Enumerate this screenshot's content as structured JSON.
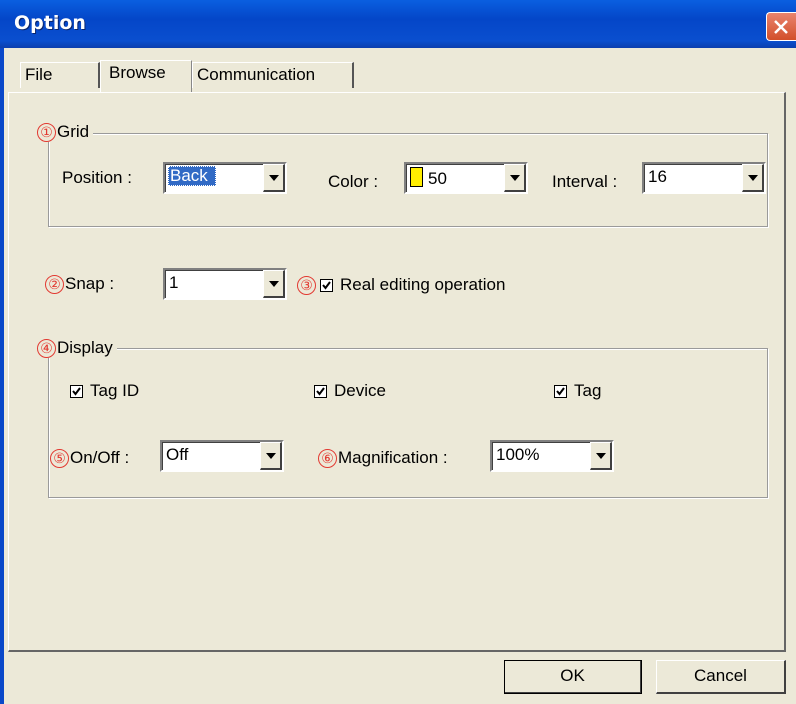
{
  "window": {
    "title": "Option",
    "close_icon": "close-icon"
  },
  "tabs": [
    {
      "label": "File",
      "active": false
    },
    {
      "label": "Browse",
      "active": true
    },
    {
      "label": "Communication",
      "active": false
    }
  ],
  "grid": {
    "number": "①",
    "legend": "Grid",
    "position_label": "Position :",
    "position_value": "Back",
    "color_label": "Color :",
    "color_value": "50",
    "color_swatch": "#ffee00",
    "interval_label": "Interval :",
    "interval_value": "16"
  },
  "snap": {
    "number": "②",
    "label": "Snap :",
    "value": "1"
  },
  "real_editing": {
    "number": "③",
    "label": "Real editing operation",
    "checked": true
  },
  "display": {
    "number": "④",
    "legend": "Display",
    "tag_id_label": "Tag ID",
    "device_label": "Device",
    "tag_label": "Tag",
    "onoff_number": "⑤",
    "onoff_label": "On/Off :",
    "onoff_value": "Off",
    "magnification_number": "⑥",
    "magnification_label": "Magnification :",
    "magnification_value": "100%"
  },
  "buttons": {
    "ok": "OK",
    "cancel": "Cancel"
  }
}
